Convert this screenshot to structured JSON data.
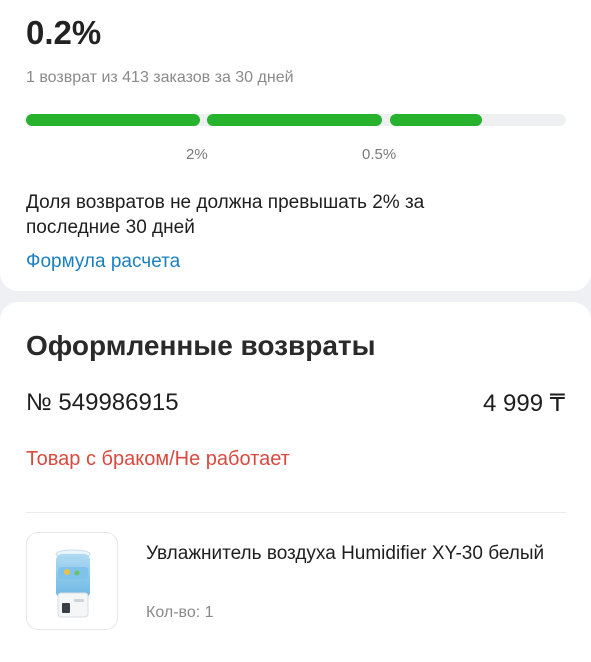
{
  "summary": {
    "rate": "0.2%",
    "subtitle": "1 возврат из 413 заказов за 30 дней",
    "progress_fraction": 0.844,
    "tick_labels": [
      "2%",
      "0.5%"
    ],
    "note": "Доля возвратов не должна превышать 2% за последние 30 дней",
    "formula_link": "Формула расчета",
    "accent_color": "#27b22e",
    "link_color": "#1a7fc0"
  },
  "returns": {
    "title": "Оформленные возвраты",
    "order_number": "№ 549986915",
    "price": "4 999 ₸",
    "reason": "Товар с браком/Не работает",
    "reason_color": "#d94a3e",
    "item": {
      "name": "Увлажнитель воздуха Humidifier XY-30 белый",
      "qty": "Кол-во: 1",
      "icon": "humidifier-product-image"
    }
  }
}
